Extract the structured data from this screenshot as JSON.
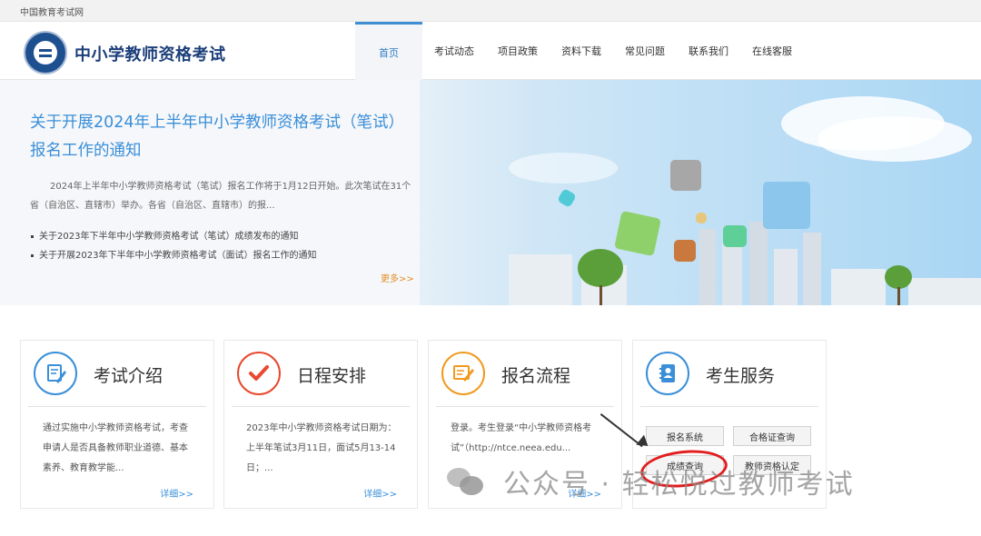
{
  "topbar": {
    "site_name": "中国教育考试网"
  },
  "header": {
    "title": "中小学教师资格考试",
    "nav": [
      "首页",
      "考试动态",
      "项目政策",
      "资料下载",
      "常见问题",
      "联系我们",
      "在线客服"
    ],
    "active_nav": "首页"
  },
  "banner": {
    "headline": "关于开展2024年上半年中小学教师资格考试（笔试）报名工作的通知",
    "summary": "2024年上半年中小学教师资格考试（笔试）报名工作将于1月12日开始。此次笔试在31个省（自治区、直辖市）举办。各省（自治区、直辖市）的报...",
    "links": [
      "关于2023年下半年中小学教师资格考试（笔试）成绩发布的通知",
      "关于开展2023年下半年中小学教师资格考试（面试）报名工作的通知"
    ],
    "more_label": "更多>>"
  },
  "cards": [
    {
      "title": "考试介绍",
      "desc": "通过实施中小学教师资格考试，考查申请人是否具备教师职业道德、基本素养、教育教学能...",
      "more": "详细>>",
      "icon": "document-pen-icon",
      "color": "#3a8fd8"
    },
    {
      "title": "日程安排",
      "desc": "2023年中小学教师资格考试日期为：上半年笔试3月11日，面试5月13-14日；...",
      "more": "详细>>",
      "icon": "checkmark-icon",
      "color": "#e8492f"
    },
    {
      "title": "报名流程",
      "desc": "登录。考生登录“中小学教师资格考试”（http://ntce.neea.edu...",
      "more": "详细>>",
      "icon": "form-pen-icon",
      "color": "#f09a1e"
    },
    {
      "title": "考生服务",
      "icon": "contact-book-icon",
      "color": "#3a8fd8"
    }
  ],
  "services": [
    "报名系统",
    "合格证查询",
    "成绩查询",
    "教师资格认定"
  ],
  "watermark": {
    "text": "公众号 · 轻松悦过教师考试"
  }
}
